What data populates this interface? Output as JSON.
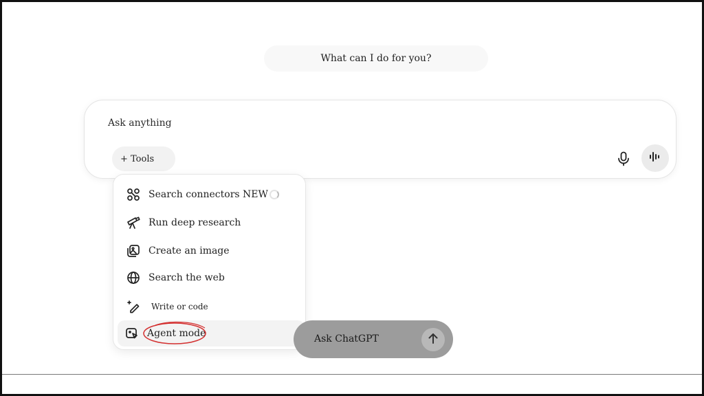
{
  "greeting": "What can I do for you?",
  "composer": {
    "input_text": "Ask anything",
    "tools_label": "+ Tools",
    "mic_icon": "microphone-icon",
    "voice_icon": "voice-waveform-icon"
  },
  "tools_menu": {
    "items": [
      {
        "label": "Search connectors NEW",
        "icon": "connectors-icon"
      },
      {
        "label": "Run deep research",
        "icon": "telescope-icon"
      },
      {
        "label": "Create an image",
        "icon": "image-icon"
      },
      {
        "label": "Search the web",
        "icon": "globe-icon"
      },
      {
        "label": "Write or code",
        "icon": "pencil-sparkle-icon"
      },
      {
        "label": "Agent mode",
        "icon": "agent-icon"
      }
    ]
  },
  "ask_chatgpt": {
    "label": "Ask ChatGPT",
    "send_icon": "arrow-up-icon"
  },
  "colors": {
    "annotation_circle": "#d32f2f",
    "ask_pill_bg": "#9c9c9c",
    "tools_bg": "#f2f2f2"
  }
}
